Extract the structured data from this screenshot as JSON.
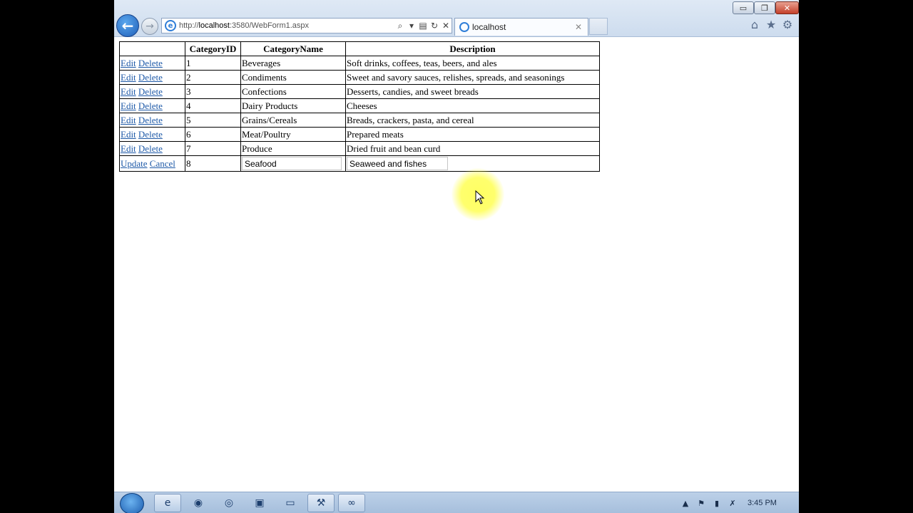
{
  "browser": {
    "address_prefix": "http://",
    "address_host": "localhost",
    "address_rest": ":3580/WebForm1.aspx",
    "tab_title": "localhost",
    "min_label": "▭",
    "max_label": "❐",
    "close_label": "✕"
  },
  "grid": {
    "headers": [
      "",
      "CategoryID",
      "CategoryName",
      "Description"
    ],
    "edit_label": "Edit",
    "delete_label": "Delete",
    "update_label": "Update",
    "cancel_label": "Cancel",
    "rows": [
      {
        "id": "1",
        "name": "Beverages",
        "description": "Soft drinks, coffees, teas, beers, and ales"
      },
      {
        "id": "2",
        "name": "Condiments",
        "description": "Sweet and savory sauces, relishes, spreads, and seasonings"
      },
      {
        "id": "3",
        "name": "Confections",
        "description": "Desserts, candies, and sweet breads"
      },
      {
        "id": "4",
        "name": "Dairy Products",
        "description": "Cheeses"
      },
      {
        "id": "5",
        "name": "Grains/Cereals",
        "description": "Breads, crackers, pasta, and cereal"
      },
      {
        "id": "6",
        "name": "Meat/Poultry",
        "description": "Prepared meats"
      },
      {
        "id": "7",
        "name": "Produce",
        "description": "Dried fruit and bean curd"
      }
    ],
    "edit_row": {
      "id": "8",
      "name_value": "Seafood",
      "description_value": "Seaweed and fishes"
    }
  },
  "taskbar": {
    "clock": "3:45 PM",
    "items": [
      "ie-icon",
      "firefox-icon",
      "chrome-icon",
      "app-icon",
      "folder-icon",
      "tool-icon",
      "vs-icon"
    ]
  },
  "colors": {
    "link": "#1f5aa8",
    "highlight": "#ffff5a"
  }
}
